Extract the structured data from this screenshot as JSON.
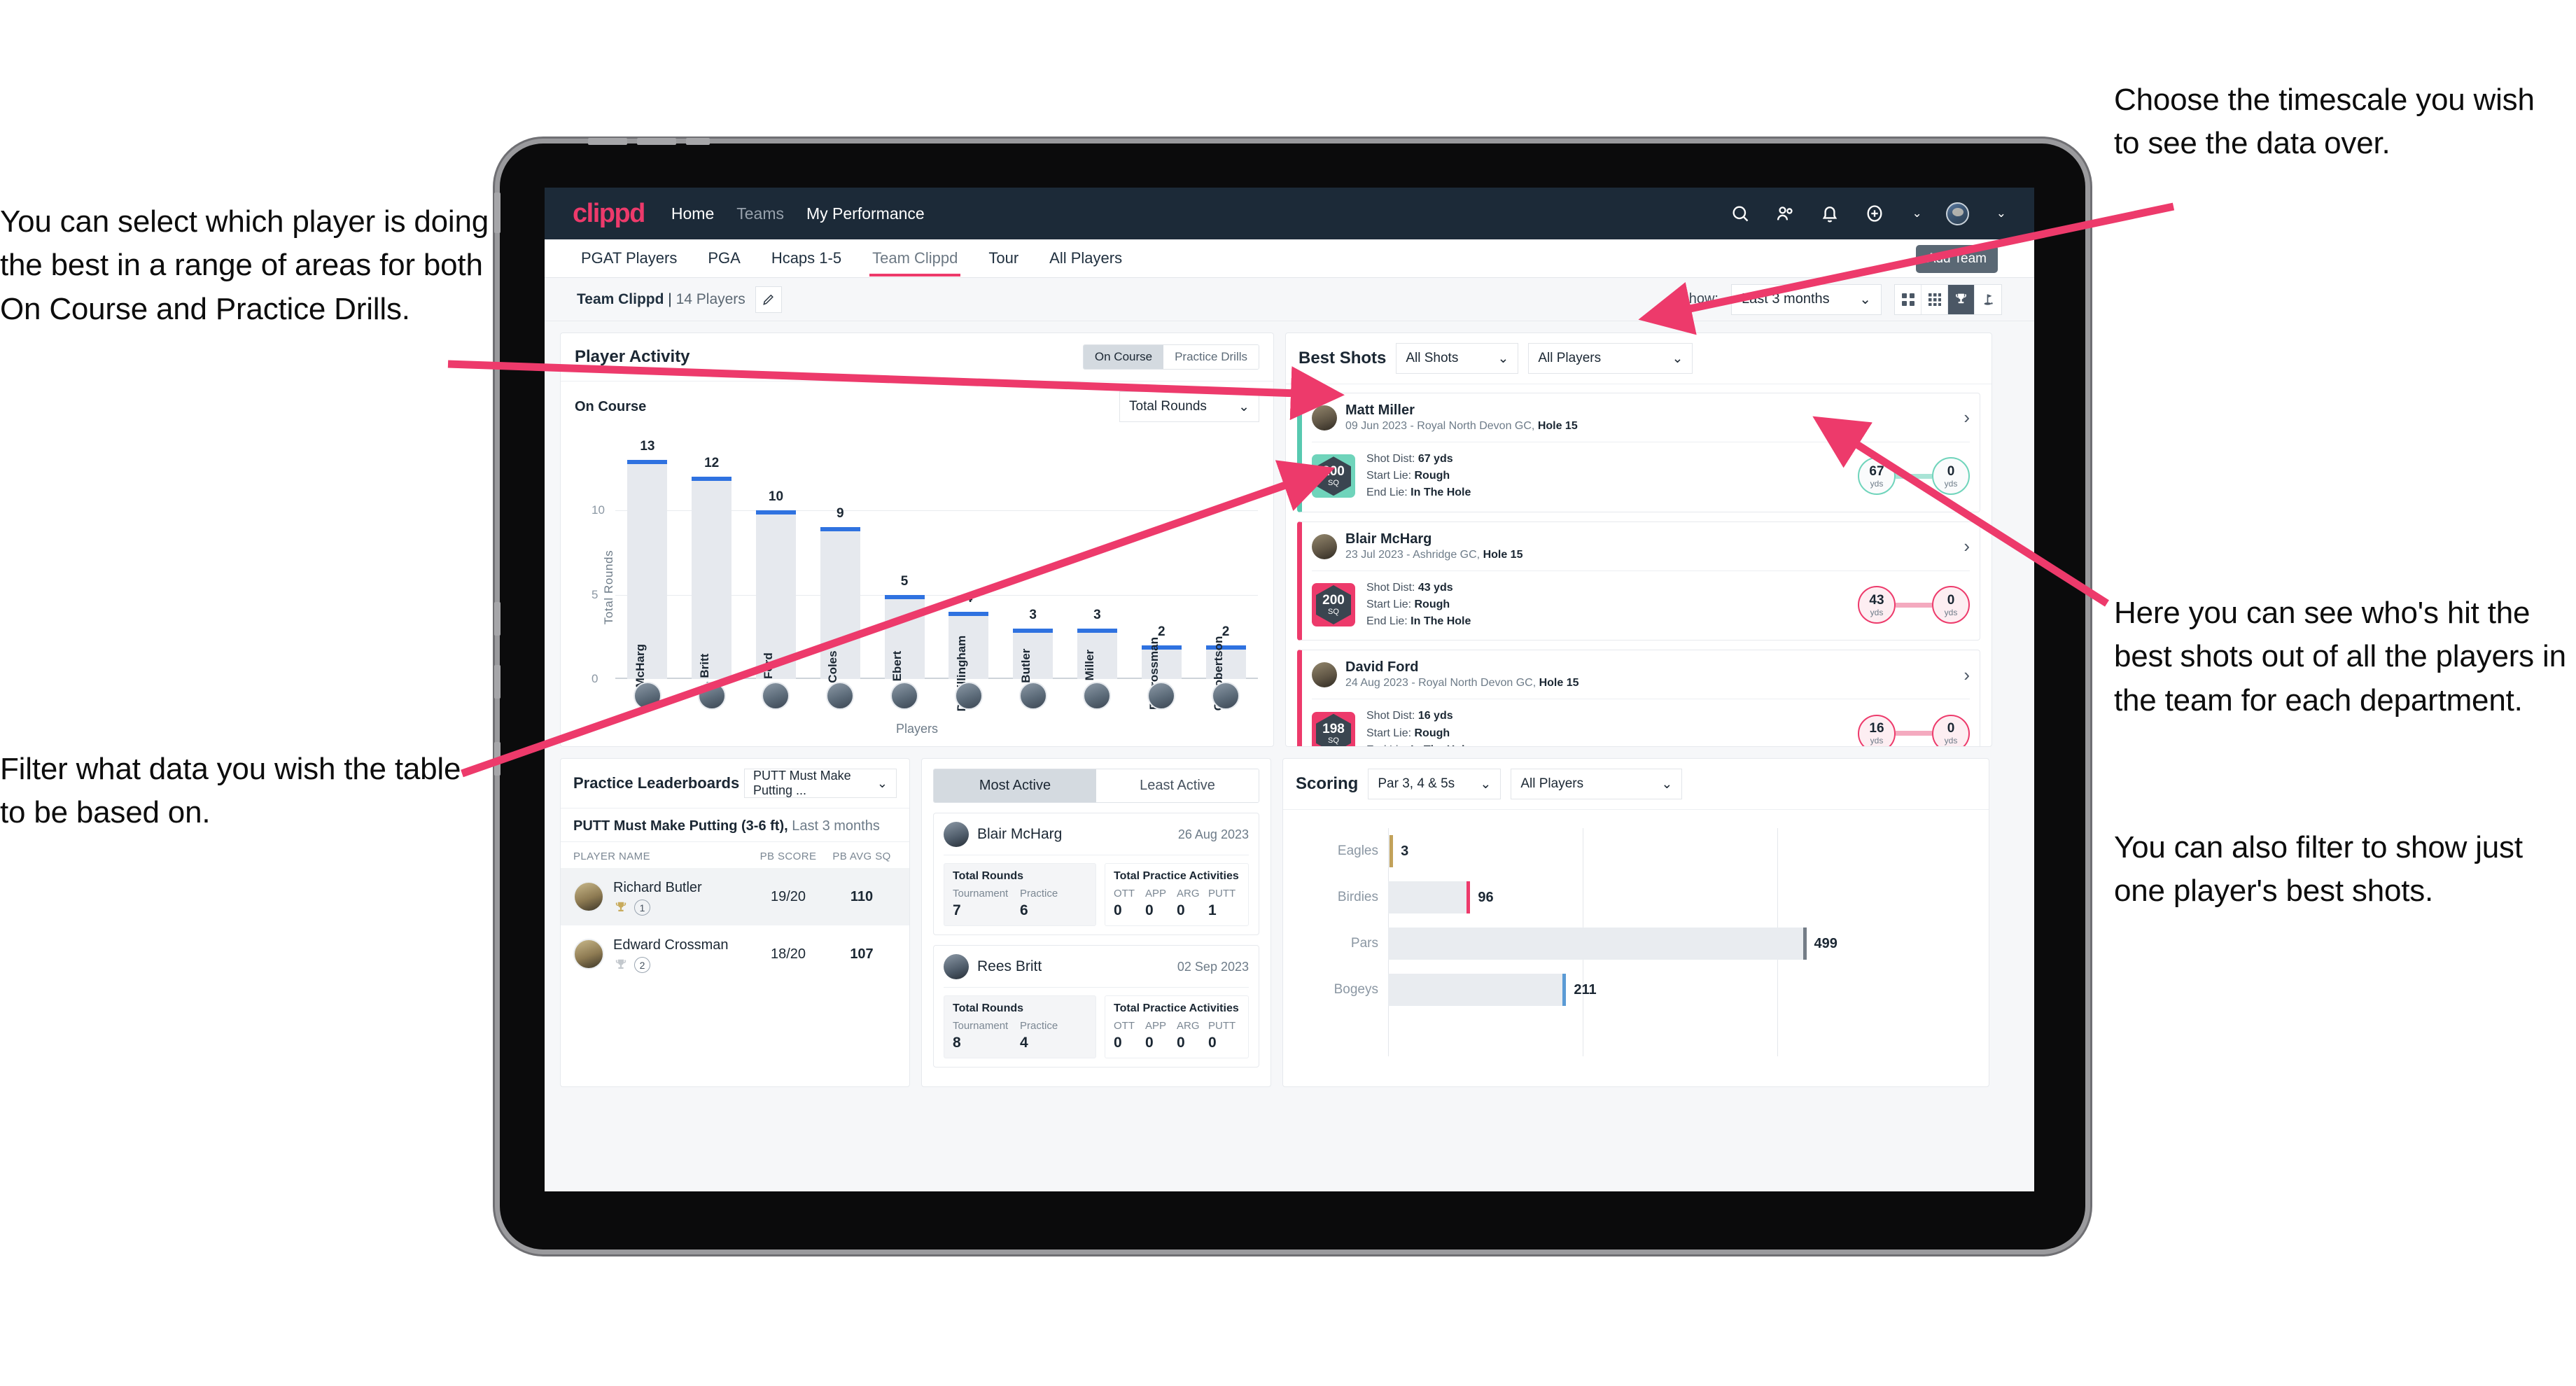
{
  "annotations": {
    "select_player": "You can select which player is doing the best in a range of areas for both On Course and Practice Drills.",
    "filter_table": "Filter what data you wish the table to be based on.",
    "timescale": "Choose the timescale you wish to see the data over.",
    "best_shots": "Here you can see who's hit the best shots out of all the players in the team for each department.",
    "filter_shots": "You can also filter to show just one player's best shots."
  },
  "navbar": {
    "brand": "clippd",
    "links": [
      {
        "label": "Home",
        "dim": false
      },
      {
        "label": "Teams",
        "dim": true
      },
      {
        "label": "My Performance",
        "dim": false
      }
    ],
    "icons": [
      "search-icon",
      "people-icon",
      "bell-icon",
      "plus-circle-icon",
      "avatar"
    ]
  },
  "tabbar": {
    "tabs": [
      {
        "label": "PGAT Players",
        "active": false
      },
      {
        "label": "PGA",
        "active": false
      },
      {
        "label": "Hcaps 1-5",
        "active": false
      },
      {
        "label": "Team Clippd",
        "active": true
      },
      {
        "label": "Tour",
        "active": false
      },
      {
        "label": "All Players",
        "active": false
      }
    ],
    "tooltip": "Add Team"
  },
  "toolbar": {
    "team_name": "Team Clippd",
    "separator": " | ",
    "player_count": "14 Players",
    "show_label": "Show:",
    "timescale_value": "Last 3 months",
    "view_buttons": [
      {
        "icon": "grid-2x2-icon",
        "active": false
      },
      {
        "icon": "grid-3x3-icon",
        "active": false
      },
      {
        "icon": "trophy-icon",
        "active": true
      },
      {
        "icon": "golf-flag-icon",
        "active": false
      }
    ]
  },
  "player_activity": {
    "title": "Player Activity",
    "segments": [
      {
        "label": "On Course",
        "active": true
      },
      {
        "label": "Practice Drills",
        "active": false
      }
    ],
    "sub_label": "On Course",
    "metric_select": "Total Rounds"
  },
  "best_shots": {
    "title": "Best Shots",
    "shot_filter": "All Shots",
    "player_filter": "All Players",
    "cards": [
      {
        "accent": "teal",
        "player": "Matt Miller",
        "meta_prefix": "09 Jun 2023 - Royal North Devon GC, ",
        "meta_hole": "Hole 15",
        "sq_value": "200",
        "sq_unit": "SQ",
        "shot_dist_label": "Shot Dist: ",
        "shot_dist_value": "67 yds",
        "start_lie_label": "Start Lie: ",
        "start_lie_value": "Rough",
        "end_lie_label": "End Lie: ",
        "end_lie_value": "In The Hole",
        "from_value": "67",
        "from_unit": "yds",
        "to_value": "0",
        "to_unit": "yds"
      },
      {
        "accent": "pink",
        "player": "Blair McHarg",
        "meta_prefix": "23 Jul 2023 - Ashridge GC, ",
        "meta_hole": "Hole 15",
        "sq_value": "200",
        "sq_unit": "SQ",
        "shot_dist_label": "Shot Dist: ",
        "shot_dist_value": "43 yds",
        "start_lie_label": "Start Lie: ",
        "start_lie_value": "Rough",
        "end_lie_label": "End Lie: ",
        "end_lie_value": "In The Hole",
        "from_value": "43",
        "from_unit": "yds",
        "to_value": "0",
        "to_unit": "yds"
      },
      {
        "accent": "pink",
        "player": "David Ford",
        "meta_prefix": "24 Aug 2023 - Royal North Devon GC, ",
        "meta_hole": "Hole 15",
        "sq_value": "198",
        "sq_unit": "SQ",
        "shot_dist_label": "Shot Dist: ",
        "shot_dist_value": "16 yds",
        "start_lie_label": "Start Lie: ",
        "start_lie_value": "Rough",
        "end_lie_label": "End Lie: ",
        "end_lie_value": "In The Hole",
        "from_value": "16",
        "from_unit": "yds",
        "to_value": "0",
        "to_unit": "yds"
      }
    ]
  },
  "practice_leaderboards": {
    "title": "Practice Leaderboards",
    "drill_select": "PUTT Must Make Putting ...",
    "sub_bold": "PUTT Must Make Putting (3-6 ft),",
    "sub_normal": " Last 3 months",
    "columns": [
      "PLAYER NAME",
      "PB SCORE",
      "PB AVG SQ"
    ],
    "rows": [
      {
        "name": "Richard Butler",
        "rank": "1",
        "trophy": "gold",
        "pb_score": "19/20",
        "pb_avg_sq": "110",
        "highlight": true
      },
      {
        "name": "Edward Crossman",
        "rank": "2",
        "trophy": "silver",
        "pb_score": "18/20",
        "pb_avg_sq": "107",
        "highlight": false
      }
    ]
  },
  "most_active": {
    "tabs": [
      {
        "label": "Most Active",
        "active": true
      },
      {
        "label": "Least Active",
        "active": false
      }
    ],
    "rounds_title": "Total Rounds",
    "acts_title": "Total Practice Activities",
    "rounds_keys": [
      "Tournament",
      "Practice"
    ],
    "acts_keys": [
      "OTT",
      "APP",
      "ARG",
      "PUTT"
    ],
    "cards": [
      {
        "player": "Blair McHarg",
        "date": "26 Aug 2023",
        "rounds": [
          "7",
          "6"
        ],
        "acts": [
          "0",
          "0",
          "0",
          "1"
        ]
      },
      {
        "player": "Rees Britt",
        "date": "02 Sep 2023",
        "rounds": [
          "8",
          "4"
        ],
        "acts": [
          "0",
          "0",
          "0",
          "0"
        ]
      }
    ]
  },
  "scoring": {
    "title": "Scoring",
    "par_filter": "Par 3, 4 & 5s",
    "player_filter": "All Players"
  },
  "chart_data": [
    {
      "type": "bar",
      "title": "Player Activity - On Course",
      "xlabel": "Players",
      "ylabel": "Total Rounds",
      "categories": [
        "B. McHarg",
        "R. Britt",
        "D. Ford",
        "J. Coles",
        "E. Ebert",
        "D. Billingham",
        "R. Butler",
        "M. Miller",
        "E. Crossman",
        "C. Robertson"
      ],
      "values": [
        13,
        12,
        10,
        9,
        5,
        4,
        3,
        3,
        2,
        2
      ],
      "ylim": [
        0,
        14
      ],
      "yticks": [
        0,
        5,
        10
      ],
      "grid": true,
      "bar_color": "#e6e9ee",
      "cap_color": "#2f72e0"
    },
    {
      "type": "bar",
      "orientation": "horizontal",
      "title": "Scoring",
      "categories": [
        "Eagles",
        "Birdies",
        "Pars",
        "Bogeys"
      ],
      "values": [
        3,
        96,
        499,
        211
      ],
      "colors": [
        "#c2a25a",
        "#ed3a6b",
        "#747d87",
        "#5b9bd5"
      ],
      "xlim": [
        0,
        700
      ],
      "grid": true
    }
  ],
  "colors": {
    "brand_pink": "#ed3a6b",
    "navy": "#1c2a38",
    "teal": "#6fd4bb",
    "bar_blue": "#2f72e0"
  }
}
